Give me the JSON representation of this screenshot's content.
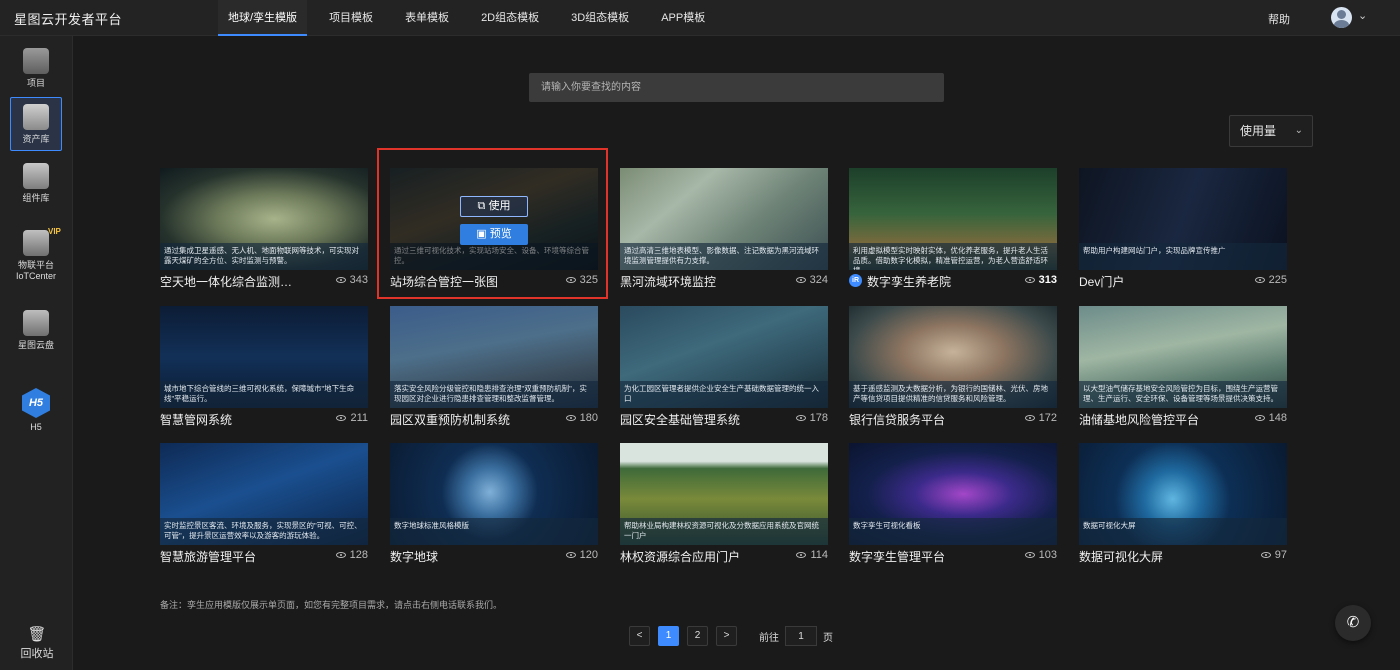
{
  "brand": "星图云开发者平台",
  "nav": {
    "tabs": [
      "地球/孪生模版",
      "项目模板",
      "表单模板",
      "2D组态模板",
      "3D组态模板",
      "APP模板"
    ],
    "active_tab": "地球/孪生模版",
    "help": "帮助"
  },
  "sidebar": {
    "items": [
      {
        "label": "项目",
        "icon": "folder-icon"
      },
      {
        "label": "资产库",
        "icon": "asset-library-icon",
        "active": true
      },
      {
        "label": "组件库",
        "icon": "component-icon"
      },
      {
        "label1": "物联平台",
        "label2": "IoTCenter",
        "icon": "iot-icon",
        "badge": "VIP"
      },
      {
        "label": "星图云盘",
        "icon": "cloud-disk-icon"
      },
      {
        "label": "H5",
        "icon": "h5-icon"
      }
    ],
    "recycle": "回收站"
  },
  "search": {
    "placeholder": "请输入你要查找的内容"
  },
  "sort": {
    "label": "使用量"
  },
  "cards": [
    {
      "title": "空天地一体化综合监测…",
      "views": "343",
      "desc": "通过集成卫星遥感、无人机、地面物联网等技术，可实现对露天煤矿的全方位、实时监测与预警。",
      "theme": "a"
    },
    {
      "title": "站场综合管控一张图",
      "views": "325",
      "desc": "通过三维可视化技术，实现站场安全、设备、环境等综合管控。",
      "theme": "b"
    },
    {
      "title": "黑河流域环境监控",
      "views": "324",
      "desc": "通过高清三维地表模型、影像数据、注记数据为黑河流域环境监测管理提供有力支撑。",
      "theme": "c"
    },
    {
      "title": "数字孪生养老院",
      "views": "313",
      "desc": "利用虚拟模型实时映射实体，优化养老服务，提升老人生活品质。借助数字化模拟，精准管控运营，为老人营造舒适环境",
      "theme": "d"
    },
    {
      "title": "Dev门户",
      "views": "225",
      "desc": "帮助用户构建网站门户，实现品牌宣传推广",
      "theme": "e"
    },
    {
      "title": "智慧管网系统",
      "views": "211",
      "desc": "城市地下综合管线的三维可视化系统，保障城市\"地下生命线\"平稳运行。",
      "theme": "f"
    },
    {
      "title": "园区双重预防机制系统",
      "views": "180",
      "desc": "落实安全风险分级管控和隐患排查治理\"双重预防机制\"，实现园区对企业进行隐患排查管理和整改监督管理。",
      "theme": "g"
    },
    {
      "title": "园区安全基础管理系统",
      "views": "178",
      "desc": "为化工园区管理者提供企业安全生产基础数据管理的统一入口",
      "theme": "h"
    },
    {
      "title": "银行信贷服务平台",
      "views": "172",
      "desc": "基于遥感监测及大数据分析，为银行的国储林、光伏、房地产等信贷项目提供精准的信贷服务和风险管理。",
      "theme": "i"
    },
    {
      "title": "油储基地风险管控平台",
      "views": "148",
      "desc": "以大型油气储存基地安全风险管控为目标，围绕生产运营管理、生产运行、安全环保、设备管理等场景提供决策支持。",
      "theme": "j"
    },
    {
      "title": "智慧旅游管理平台",
      "views": "128",
      "desc": "实时监控景区客流、环境及服务，实现景区的\"可视、可控、可管\"，提升景区运营效率以及游客的游玩体验。",
      "theme": "k"
    },
    {
      "title": "数字地球",
      "views": "120",
      "desc": "数字地球标准风格模版",
      "theme": "l"
    },
    {
      "title": "林权资源综合应用门户",
      "views": "114",
      "desc": "帮助林业局构建林权资源可视化及分数据应用系统及官网统一门户",
      "theme": "m"
    },
    {
      "title": "数字孪生管理平台",
      "views": "103",
      "desc": "数字孪生可视化看板",
      "theme": "n"
    },
    {
      "title": "数据可视化大屏",
      "views": "97",
      "desc": "数据可视化大屏",
      "theme": "o"
    }
  ],
  "hover": {
    "use": "使用",
    "preview": "预览"
  },
  "note": "备注：孪生应用模版仅展示单页面，如您有完整项目需求，请点击右侧电话联系我们。",
  "pager": {
    "prev": "<",
    "pages": [
      "1",
      "2"
    ],
    "current": "1",
    "next": ">",
    "goto_label": "前往",
    "goto_value": "1",
    "page_unit": "页"
  }
}
